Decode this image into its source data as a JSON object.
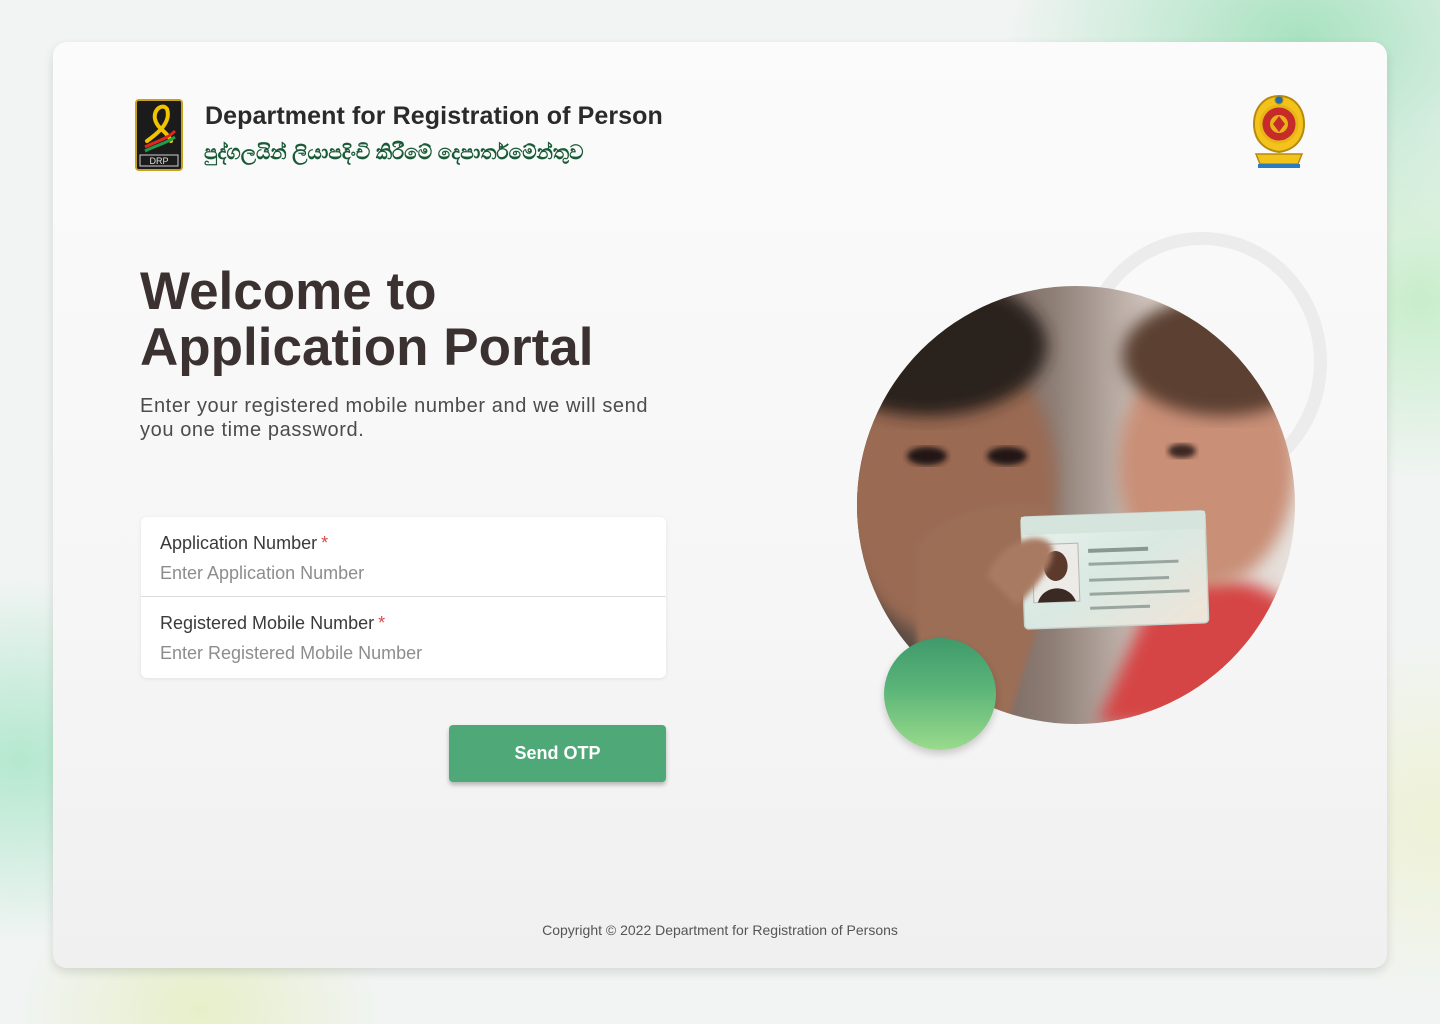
{
  "header": {
    "org_name_en": "Department for Registration of Person",
    "org_name_si": "පුද්ගලයින් ලියාපදිංචි කිරීමේ දෙපාර්තමේන්තුව",
    "logo_text": "DRP",
    "logo_icon": "drp-logo",
    "emblem_icon": "sri-lanka-emblem"
  },
  "hero": {
    "title_line1": "Welcome to",
    "title_line2": "Application Portal",
    "subtitle": "Enter your registered mobile number and we will send you one time password."
  },
  "form": {
    "application_number": {
      "label": "Application Number",
      "required_mark": "*",
      "placeholder": "Enter Application Number",
      "value": ""
    },
    "mobile_number": {
      "label": "Registered Mobile Number",
      "required_mark": "*",
      "placeholder": "Enter Registered Mobile Number",
      "value": ""
    },
    "submit_label": "Send OTP"
  },
  "footer": {
    "copyright": "Copyright © 2022 Department for Registration of Persons"
  },
  "colors": {
    "accent": "#4fa877",
    "title": "#3b3131",
    "sinhala_text": "#1a5b37",
    "required": "#d84a4a"
  }
}
